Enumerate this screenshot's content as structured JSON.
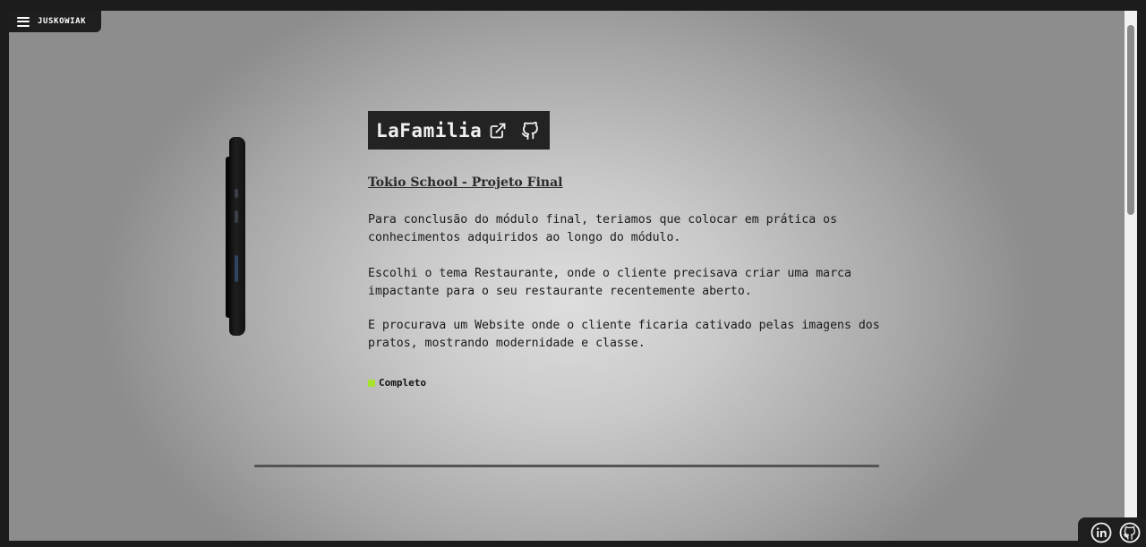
{
  "nav": {
    "brand": "JUSKOWIAK",
    "menu_icon": "hamburger-menu-icon"
  },
  "project": {
    "title": "LaFamilia",
    "external_link_icon": "external-link-icon",
    "github_icon": "github-icon",
    "subtitle": "Tokio School - Projeto Final",
    "paragraphs": [
      "Para conclusão do módulo final, teriamos que colocar em prática os conhecimentos adquiridos ao longo do módulo.",
      "Escolhi o tema Restaurante, onde o cliente precisava criar uma marca impactante para o seu restaurante recentemente aberto.",
      "E procurava um Website onde o cliente ficaria cativado pelas imagens dos pratos, mostrando modernidade e classe."
    ],
    "status": "Completo",
    "status_color": "#a6e22e"
  },
  "social": {
    "linkedin_icon": "linkedin-icon",
    "github_icon": "github-icon"
  },
  "colors": {
    "title_bg": "#232323",
    "frame": "#1c1c1c"
  }
}
